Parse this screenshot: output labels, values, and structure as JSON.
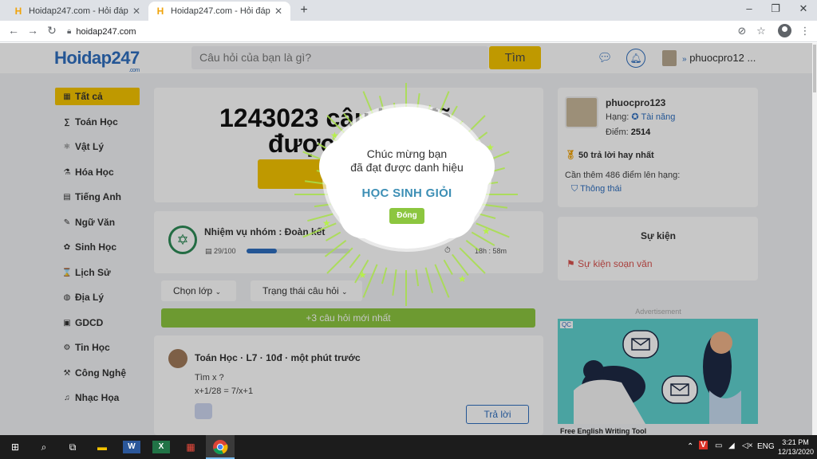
{
  "browser": {
    "tabs": [
      {
        "title": "Hoidap247.com - Hỏi đáp bài tập"
      },
      {
        "title": "Hoidap247.com - Hỏi đáp bài tập"
      }
    ],
    "address": "hoidap247.com"
  },
  "header": {
    "logo": "Hoidap247",
    "logo_domain": ".com",
    "search_placeholder": "Câu hỏi của bạn là gì?",
    "search_button": "Tìm",
    "username": "phuocpro12 ..."
  },
  "sidebar": {
    "items": [
      {
        "label": "Tất cả",
        "icon": "grid-icon",
        "glyph": "▦"
      },
      {
        "label": "Toán Học",
        "icon": "math-icon",
        "glyph": "∑"
      },
      {
        "label": "Vật Lý",
        "icon": "physics-icon",
        "glyph": "⚛"
      },
      {
        "label": "Hóa Học",
        "icon": "chemistry-icon",
        "glyph": "⚗"
      },
      {
        "label": "Tiếng Anh",
        "icon": "english-icon",
        "glyph": "▤"
      },
      {
        "label": "Ngữ Văn",
        "icon": "literature-icon",
        "glyph": "✎"
      },
      {
        "label": "Sinh Học",
        "icon": "biology-icon",
        "glyph": "✿"
      },
      {
        "label": "Lịch Sử",
        "icon": "history-icon",
        "glyph": "⌛"
      },
      {
        "label": "Địa Lý",
        "icon": "geography-icon",
        "glyph": "◍"
      },
      {
        "label": "GDCD",
        "icon": "civics-icon",
        "glyph": "▣"
      },
      {
        "label": "Tin Học",
        "icon": "informatics-icon",
        "glyph": "⚙"
      },
      {
        "label": "Công Nghệ",
        "icon": "technology-icon",
        "glyph": "⚒"
      },
      {
        "label": "Nhạc Họa",
        "icon": "music-icon",
        "glyph": "♫"
      }
    ]
  },
  "main": {
    "count_line1": "1243023 câu hỏi đã",
    "count_line2": "được",
    "mission_title": "Nhiệm vụ nhóm : Đoàn kết",
    "mission_progress_text": "29/100",
    "mission_progress": 0.29,
    "mission_time": "18h : 58m",
    "filter_grade": "Chọn lớp",
    "filter_status": "Trạng thái câu hỏi",
    "new_questions": "+3 câu hỏi mới nhất",
    "question": {
      "meta": "Toán Học · L7 · 10đ · một phút trước",
      "line1": "Tìm x ?",
      "line2": "x+1/28 = 7/x+1",
      "answer_button": "Trả lời"
    }
  },
  "right": {
    "name": "phuocpro123",
    "rank_label": "Hạng:",
    "rank_value": "Tài năng",
    "score_label": "Điểm:",
    "score_value": "2514",
    "best_answers": "50 trả lời hay nhất",
    "need_points": "Cần thêm 486 điểm lên hạng:",
    "next_rank": "Thông thái",
    "events_title": "Sự kiện",
    "event_item": "Sự kiện soạn văn",
    "ad_label": "Advertisement",
    "ad_caption": "Free English Writing Tool"
  },
  "modal": {
    "line1": "Chúc mừng bạn",
    "line2": "đã đạt được danh hiệu",
    "title": "HỌC SINH GIỎI",
    "close": "Đóng"
  },
  "taskbar": {
    "lang": "ENG",
    "time": "3:21 PM",
    "date": "12/13/2020"
  },
  "colors": {
    "accent": "#f5c400",
    "brand": "#2f6fbf",
    "green": "#8cc63f"
  }
}
